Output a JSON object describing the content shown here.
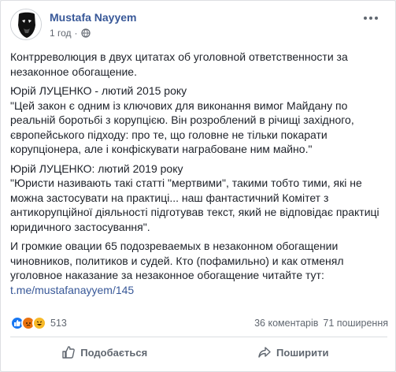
{
  "post": {
    "author": "Mustafa Nayyem",
    "time": "1 год",
    "paragraphs": [
      "Контрреволюция в двух цитатах об уголовной ответственности за незаконное обогащение.",
      "Юрій ЛУЦЕНКО - лютий 2015 року\n\"Цей закон є одним із ключових для виконання вимог Майдану по реальній боротьбі з корупцією. Він розроблений в річищі західного, європейського підходу: про те, що головне не тільки покарати корупціонера, але і конфіскувати награбоване ним майно.\"",
      "Юрій ЛУЦЕНКО: лютий 2019 року\n\"Юристи називають такі статті \"мертвими\", такими тобто тими, які не можна застосувати на практиці... наш фантастичний Комітет з антикорупційної діяльності підготував текст, який не відповідає практиці юридичного застосування\"."
    ],
    "final_text": "И громкие овации 65 подозреваемых в незаконном обогащении чиновников, политиков и судей. Кто (пофамильно) и как отменял уголовное наказание за незаконное обогащение читайте тут:",
    "link": "t.me/mustafanayyem/145"
  },
  "stats": {
    "reaction_count": "513",
    "comments": "36 коментарів",
    "shares": "71 поширення"
  },
  "actions": {
    "like": "Подобається",
    "share": "Поширити"
  },
  "colors": {
    "link": "#385898",
    "like_blue": "#1877f2",
    "angry": "#e9710f",
    "haha": "#f7b928"
  }
}
